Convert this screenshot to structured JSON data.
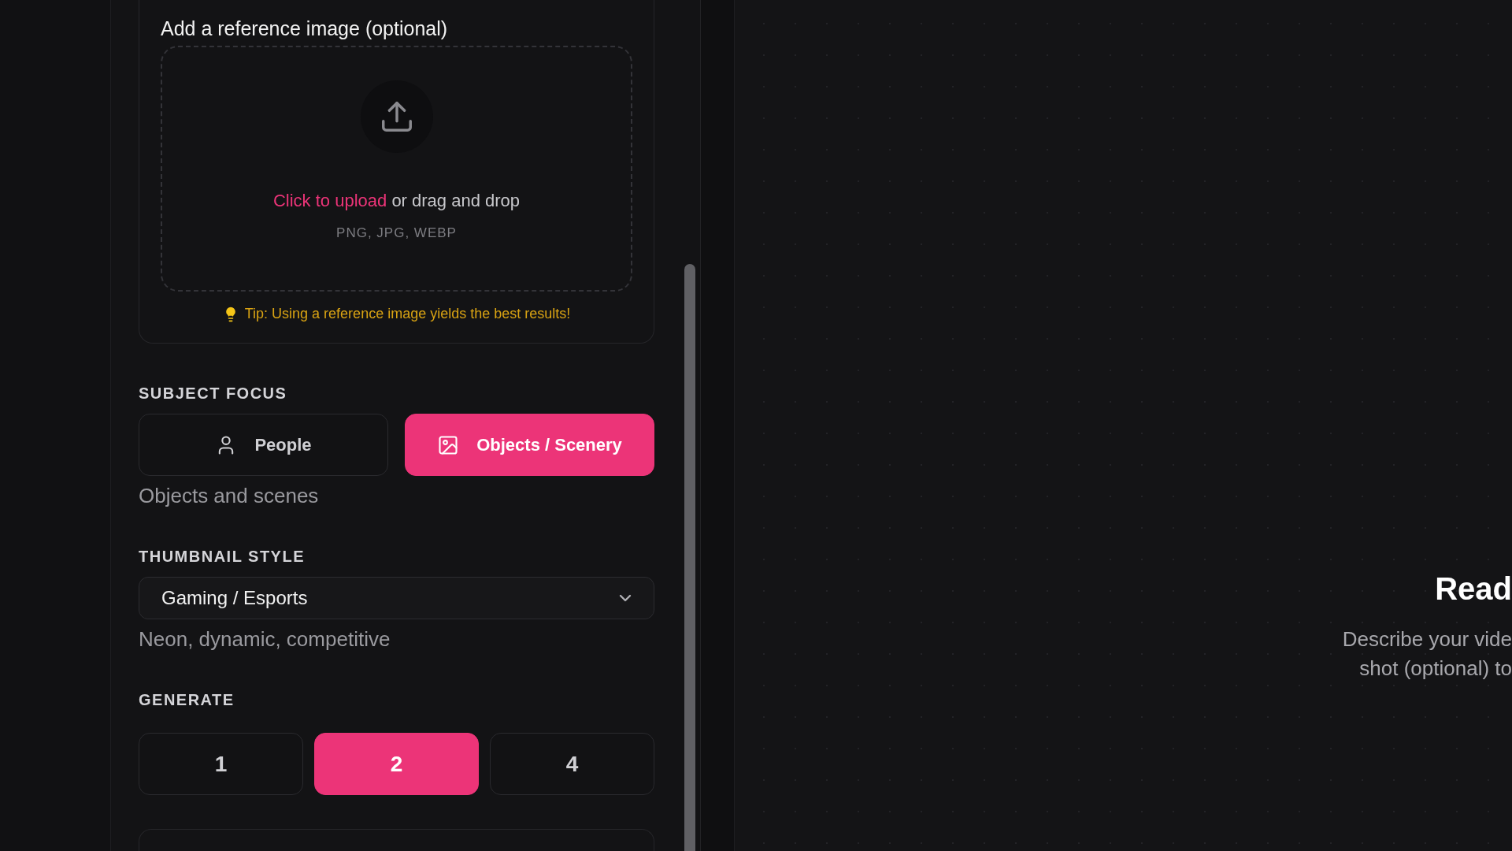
{
  "reference": {
    "label": "Add a reference image (optional)",
    "upload_link": "Click to upload",
    "upload_text": "or drag and drop",
    "formats": "PNG, JPG, WEBP",
    "tip": "Tip: Using a reference image yields the best results!"
  },
  "subject_focus": {
    "label": "SUBJECT FOCUS",
    "options": [
      {
        "label": "People",
        "kind": "person",
        "selected": false
      },
      {
        "label": "Objects / Scenery",
        "kind": "image",
        "selected": true
      }
    ],
    "hint": "Objects and scenes"
  },
  "thumbnail_style": {
    "label": "THUMBNAIL STYLE",
    "value": "Gaming / Esports",
    "hint": "Neon, dynamic, competitive"
  },
  "generate": {
    "label": "GENERATE",
    "options": [
      {
        "label": "1",
        "selected": false
      },
      {
        "label": "2",
        "selected": true
      },
      {
        "label": "4",
        "selected": false
      }
    ]
  },
  "preview": {
    "title": "Read",
    "description_lines": [
      "Describe your vide",
      "shot (optional) to"
    ]
  }
}
